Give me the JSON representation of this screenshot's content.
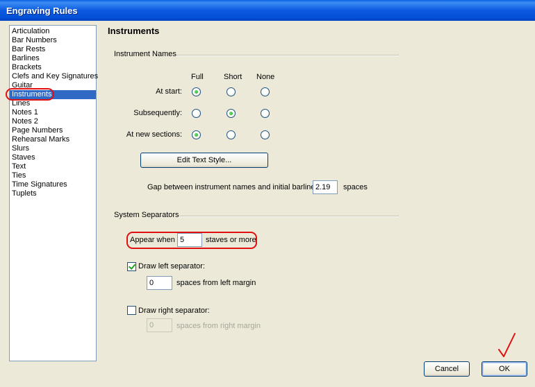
{
  "window": {
    "title": "Engraving Rules"
  },
  "sidebar": {
    "items": [
      {
        "label": "Articulation"
      },
      {
        "label": "Bar Numbers"
      },
      {
        "label": "Bar Rests"
      },
      {
        "label": "Barlines"
      },
      {
        "label": "Brackets"
      },
      {
        "label": "Clefs and Key Signatures"
      },
      {
        "label": "Guitar"
      },
      {
        "label": "Instruments",
        "selected": true
      },
      {
        "label": "Lines"
      },
      {
        "label": "Notes 1"
      },
      {
        "label": "Notes 2"
      },
      {
        "label": "Page Numbers"
      },
      {
        "label": "Rehearsal Marks"
      },
      {
        "label": "Slurs"
      },
      {
        "label": "Staves"
      },
      {
        "label": "Text"
      },
      {
        "label": "Ties"
      },
      {
        "label": "Time Signatures"
      },
      {
        "label": "Tuplets"
      }
    ]
  },
  "panel": {
    "title": "Instruments",
    "instrument_names": {
      "group_label": "Instrument Names",
      "columns": [
        "Full",
        "Short",
        "None"
      ],
      "rows": [
        {
          "label": "At start:",
          "selected": "Full"
        },
        {
          "label": "Subsequently:",
          "selected": "Short"
        },
        {
          "label": "At new sections:",
          "selected": "Full"
        }
      ],
      "edit_text_style_label": "Edit Text Style...",
      "gap_label": "Gap between instrument names and initial barline",
      "gap_value": "2.19",
      "gap_unit": "spaces"
    },
    "system_separators": {
      "group_label": "System Separators",
      "appear_when_label": "Appear when",
      "appear_when_value": "5",
      "appear_when_suffix": "staves or more",
      "draw_left_label": "Draw left separator:",
      "draw_left_checked": true,
      "left_value": "0",
      "left_suffix": "spaces from left margin",
      "draw_right_label": "Draw right separator:",
      "draw_right_checked": false,
      "right_value": "0",
      "right_suffix": "spaces from right margin"
    }
  },
  "footer": {
    "cancel_label": "Cancel",
    "ok_label": "OK"
  },
  "colors": {
    "selection": "#316ac5",
    "annotation": "#e01010",
    "titlebar": "#0a5fe0"
  }
}
